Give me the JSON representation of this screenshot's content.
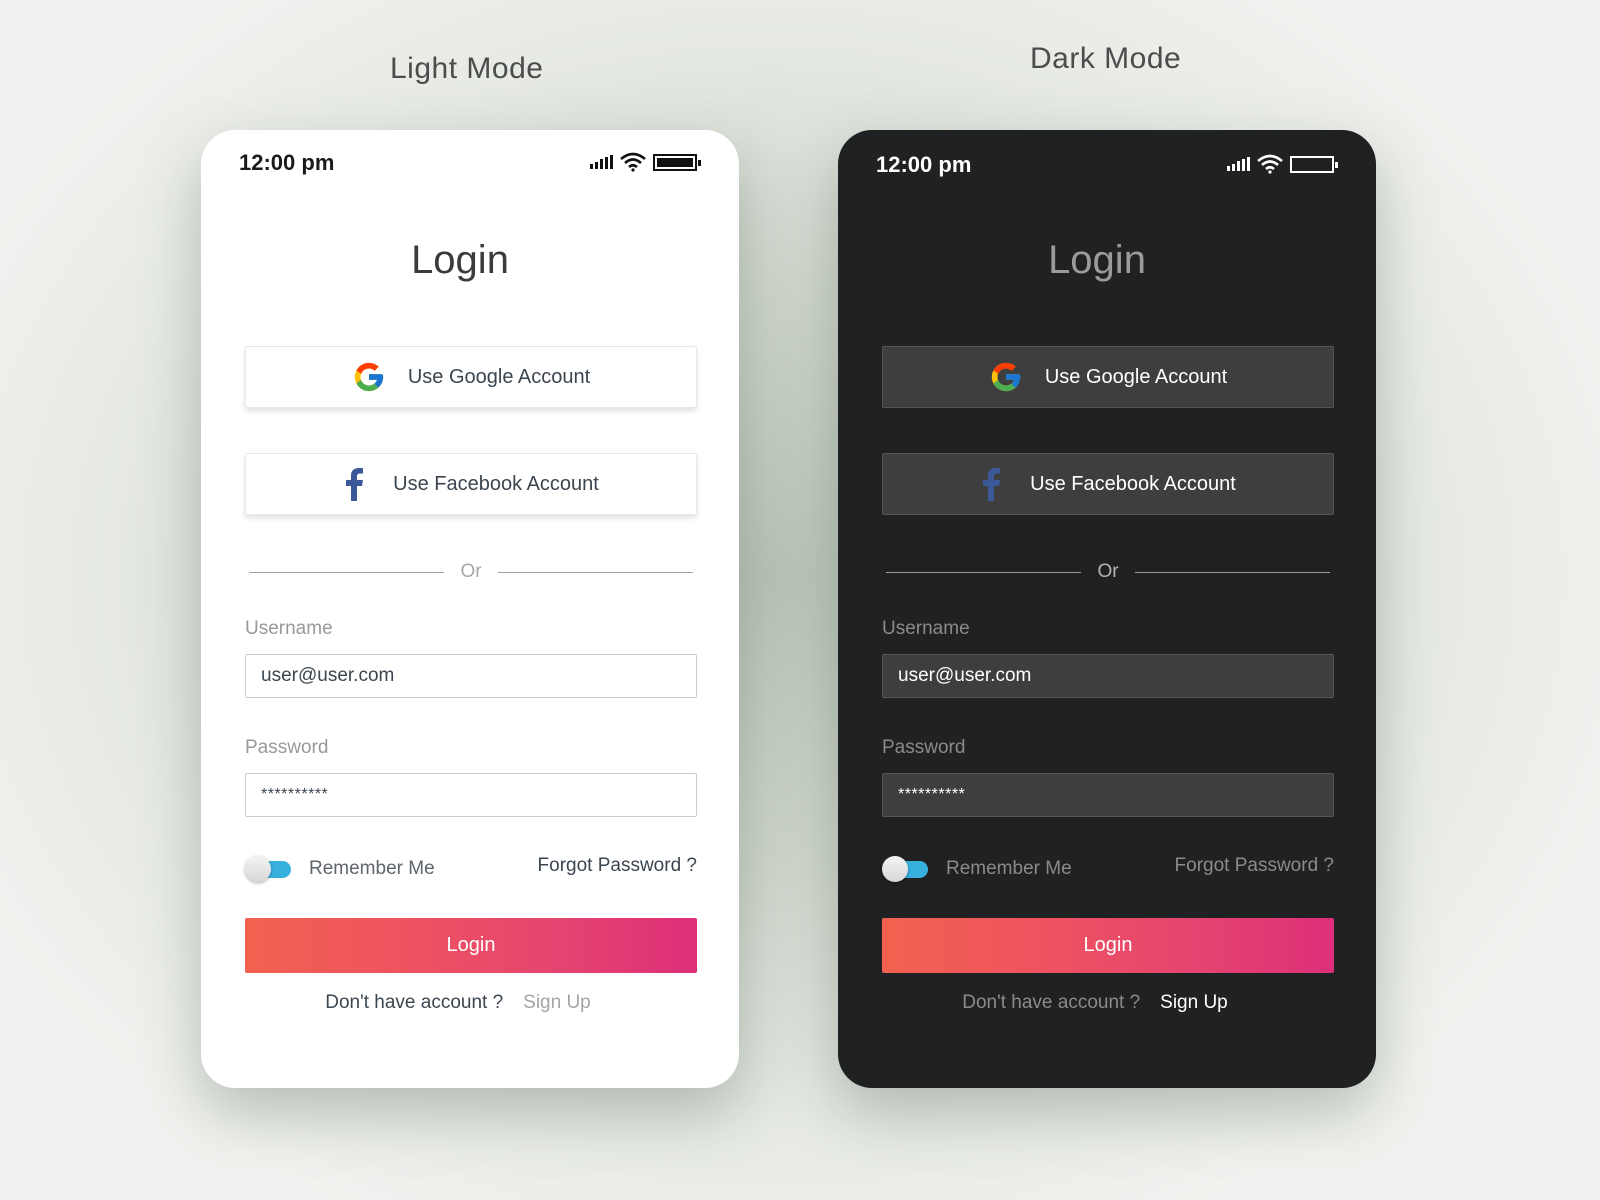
{
  "labels": {
    "light_mode": "Light Mode",
    "dark_mode": "Dark Mode"
  },
  "status_bar": {
    "time": "12:00 pm",
    "icons": [
      "signal-icon",
      "wifi-icon",
      "battery-icon"
    ]
  },
  "login": {
    "title": "Login",
    "google_button": "Use Google Account",
    "facebook_button": "Use Facebook Account",
    "divider_text": "Or",
    "username_label": "Username",
    "username_value": "user@user.com",
    "password_label": "Password",
    "password_value": "**********",
    "remember_me": "Remember Me",
    "remember_me_on": true,
    "forgot_password": "Forgot Password ?",
    "login_button": "Login",
    "no_account_text": "Don't have account ?",
    "signup_link": "Sign Up"
  },
  "colors": {
    "gradient_start": "#f2614f",
    "gradient_end": "#dd2f79",
    "toggle_track": "#38b0de",
    "dark_bg": "#202123",
    "dark_surface": "#3e3e3f",
    "facebook_blue": "#3b5998"
  }
}
